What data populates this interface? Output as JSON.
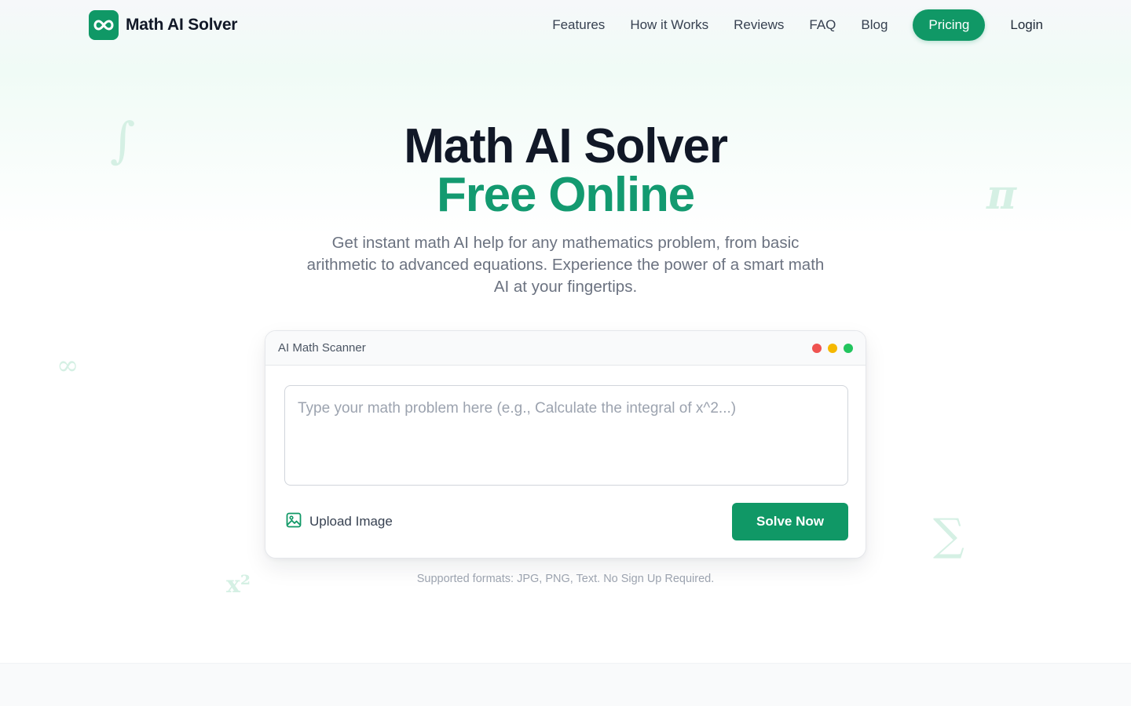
{
  "brand": {
    "name": "Math AI Solver",
    "logo_icon": "infinity-icon"
  },
  "nav": {
    "links": [
      "Features",
      "How it Works",
      "Reviews",
      "FAQ",
      "Blog"
    ],
    "pricing_label": "Pricing",
    "login_label": "Login"
  },
  "decorations": {
    "integral": "∫",
    "pi": "π",
    "infinity": "∞",
    "sigma": "∑",
    "x_squared": "x²"
  },
  "hero": {
    "title_line1": "Math AI Solver",
    "title_line2": "Free Online",
    "description": "Get instant math AI help for any mathematics problem, from basic arithmetic to advanced equations. Experience the power of a smart math AI at your fingertips."
  },
  "scanner": {
    "title": "AI Math Scanner",
    "input_value": "",
    "input_placeholder": "Type your math problem here (e.g., Calculate the integral of x^2...)",
    "upload_label": "Upload Image",
    "upload_icon": "image-icon",
    "solve_label": "Solve Now",
    "window_dot_colors": [
      "#ef5350",
      "#f5b800",
      "#22c55e"
    ]
  },
  "footer_note": "Supported formats: JPG, PNG, Text. No Sign Up Required.",
  "colors": {
    "brand_green": "#109866",
    "title_green": "#139a70",
    "symbol_tint": "#d5f0e4"
  }
}
